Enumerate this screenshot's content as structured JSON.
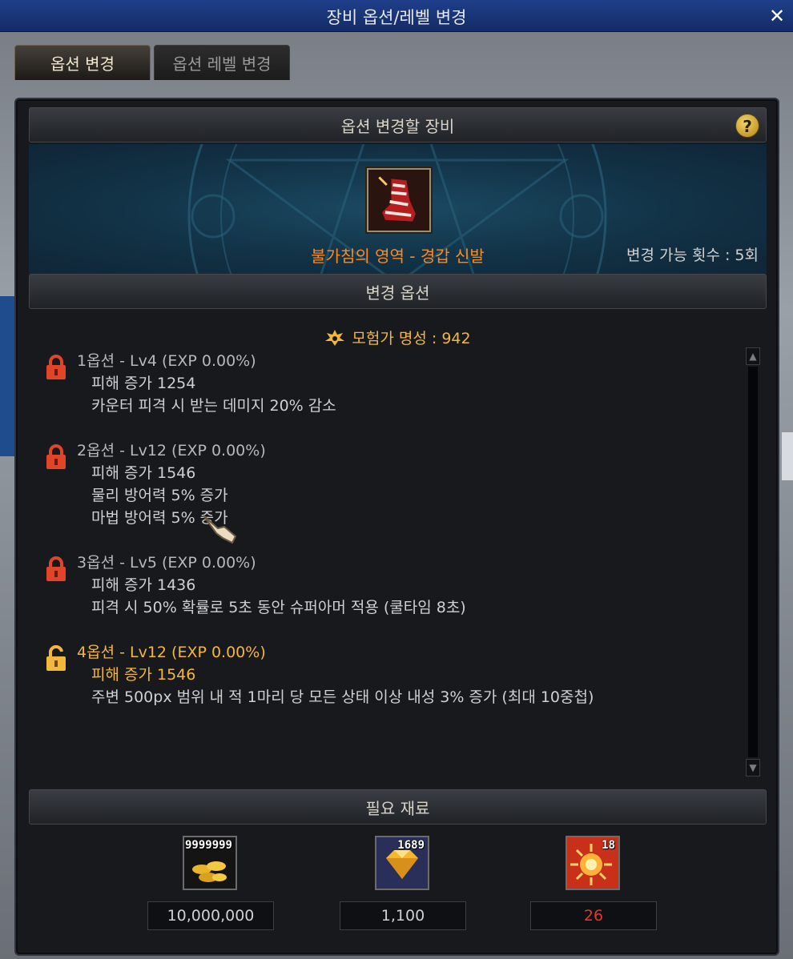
{
  "window": {
    "title": "장비 옵션/레벨 변경",
    "close_label": "✕"
  },
  "tabs": [
    {
      "label": "옵션 변경",
      "active": true
    },
    {
      "label": "옵션 레벨 변경",
      "active": false
    }
  ],
  "equipment": {
    "header": "옵션 변경할 장비",
    "help_label": "?",
    "item_name": "불가침의 영역 - 경갑 신발",
    "change_count": "변경 가능 횟수 : 5회"
  },
  "options": {
    "header": "변경 옵션",
    "fame": "모험가 명성 : 942",
    "list": [
      {
        "title": "1옵션 - Lv4 (EXP 0.00%)",
        "locked": true,
        "lines": [
          "피해 증가 1254",
          "카운터 피격 시 받는 데미지 20% 감소"
        ]
      },
      {
        "title": "2옵션 - Lv12 (EXP 0.00%)",
        "locked": true,
        "lines": [
          "피해 증가 1546",
          "물리 방어력 5% 증가",
          "마법 방어력 5% 증가"
        ]
      },
      {
        "title": "3옵션 - Lv5 (EXP 0.00%)",
        "locked": true,
        "lines": [
          "피해 증가 1436",
          "피격 시 50% 확률로 5초 동안 슈퍼아머 적용 (쿨타임 8초)"
        ]
      },
      {
        "title": "4옵션 - Lv12 (EXP 0.00%)",
        "locked": false,
        "lines": [
          "피해 증가 1546",
          "주변 500px 범위 내 적 1마리 당 모든 상태 이상 내성 3% 증가 (최대 10중첩)"
        ]
      }
    ]
  },
  "materials": {
    "header": "필요 재료",
    "items": [
      {
        "icon": "gold-coins-icon",
        "stock": "9999999",
        "required": "10,000,000",
        "insufficient": false
      },
      {
        "icon": "gem-icon",
        "stock": "1689",
        "required": "1,100",
        "insufficient": false
      },
      {
        "icon": "burst-orb-icon",
        "stock": "18",
        "required": "26",
        "insufficient": true
      }
    ]
  },
  "colors": {
    "accent_gold": "#f3b73b",
    "item_orange": "#ff8a1c",
    "lock_red": "#e0452a",
    "insufficient_red": "#e03a2a"
  }
}
